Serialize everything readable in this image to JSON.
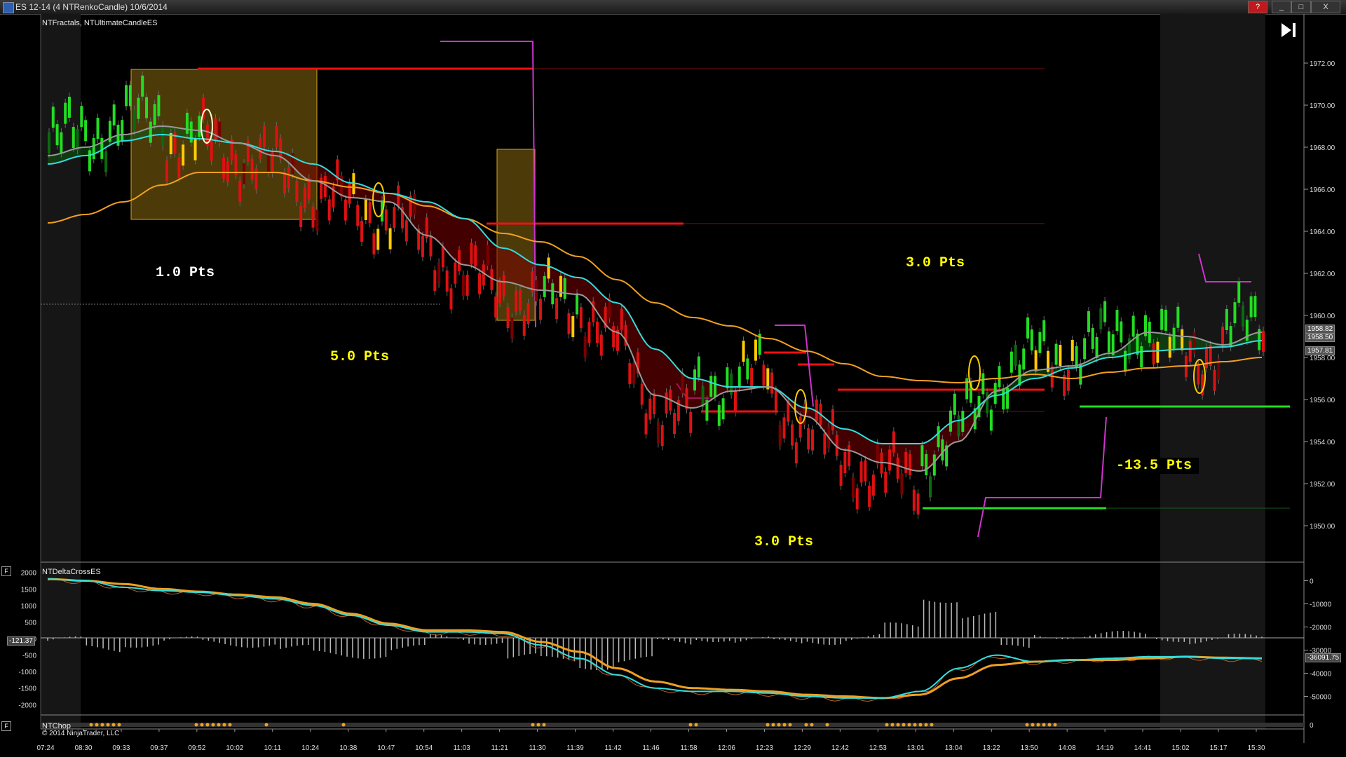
{
  "window": {
    "title": "ES 12-14 (4 NTRenkoCandle)  10/6/2014",
    "buttons": {
      "help": "?",
      "minimize": "_",
      "maximize": "□",
      "close": "X"
    }
  },
  "panels": {
    "price": {
      "label": "NTFractals, NTUltimateCandleES"
    },
    "delta": {
      "label": "NTDeltaCrossES"
    },
    "chop": {
      "label": "NTChop"
    }
  },
  "copyright": "© 2014 NinjaTrader, LLC",
  "panel_icons": {
    "delta_collapse": "F",
    "chop_collapse": "F"
  },
  "annotations": [
    {
      "text": "1.0 Pts",
      "color": "#ffffff"
    },
    {
      "text": "5.0 Pts",
      "color": "#ffff00"
    },
    {
      "text": "3.0 Pts",
      "color": "#ffff00"
    },
    {
      "text": "3.0 Pts",
      "color": "#ffff00"
    },
    {
      "text": "-13.5 Pts",
      "color": "#ffff00"
    }
  ],
  "price_labels": [
    "1958.82",
    "1958.50",
    "1957.81"
  ],
  "delta_left_label": "-121.37",
  "delta_right_label": "-36091.75",
  "price_axis": [
    "1972.00",
    "1970.00",
    "1968.00",
    "1966.00",
    "1964.00",
    "1962.00",
    "1960.00",
    "1958.00",
    "1956.00",
    "1954.00",
    "1952.00",
    "1950.00"
  ],
  "delta_left_axis": [
    "2000",
    "1500",
    "1000",
    "500",
    "0",
    "-500",
    "-1000",
    "-1500",
    "-2000"
  ],
  "delta_right_axis": [
    "0",
    "-10000",
    "-20000",
    "-30000",
    "-40000",
    "-50000"
  ],
  "chop_axis": [
    "0"
  ],
  "time_axis": [
    "07:24",
    "08:30",
    "09:33",
    "09:37",
    "09:52",
    "10:02",
    "10:11",
    "10:24",
    "10:38",
    "10:47",
    "10:54",
    "11:03",
    "11:21",
    "11:30",
    "11:39",
    "11:42",
    "11:46",
    "11:58",
    "12:06",
    "12:23",
    "12:29",
    "12:42",
    "12:53",
    "13:01",
    "13:04",
    "13:22",
    "13:50",
    "14:08",
    "14:19",
    "14:41",
    "15:02",
    "15:17",
    "15:30"
  ],
  "colors": {
    "bull": "#22dd22",
    "bear": "#dd1111",
    "neutral": "#ffcc00",
    "cyan_ma": "#33dddd",
    "orange_ma": "#f0a020",
    "gray_ma": "#999999",
    "fractal": "#cc33cc",
    "support": "#22dd22",
    "resistance": "#ee1111"
  },
  "chart_data": {
    "type": "line",
    "symbol": "ES 12-14",
    "bar_type": "4 NTRenkoCandle",
    "price_ylim": [
      1949,
      1973
    ],
    "cyan_ma": [
      1967.2,
      1967.6,
      1968.3,
      1968.6,
      1968.4,
      1968.2,
      1967.8,
      1967.2,
      1966.3,
      1965.8,
      1965.4,
      1964.6,
      1963.2,
      1962.4,
      1961.8,
      1960.6,
      1958.4,
      1957.0,
      1956.6,
      1956.6,
      1955.6,
      1954.6,
      1953.9,
      1953.9,
      1955.0,
      1956.2,
      1957.0,
      1957.5,
      1958.0,
      1958.3,
      1958.4,
      1958.5,
      1958.8
    ],
    "orange_ma": [
      1964.4,
      1964.8,
      1965.4,
      1966.2,
      1966.8,
      1966.8,
      1966.8,
      1966.4,
      1966.1,
      1965.8,
      1965.2,
      1964.6,
      1963.9,
      1963.5,
      1962.8,
      1961.7,
      1960.6,
      1959.9,
      1959.5,
      1958.9,
      1958.3,
      1957.7,
      1957.1,
      1956.9,
      1956.8,
      1957.0,
      1957.2,
      1957.0,
      1957.3,
      1957.5,
      1957.6,
      1957.8,
      1958.0
    ],
    "gray_ma": [
      1967.6,
      1968.0,
      1968.6,
      1969.0,
      1968.8,
      1968.2,
      1967.6,
      1966.4,
      1965.6,
      1965.4,
      1963.8,
      1962.4,
      1961.6,
      1961.2,
      1961.0,
      1959.2,
      1956.2,
      1955.6,
      1956.4,
      1956.6,
      1955.2,
      1953.6,
      1953.0,
      1952.6,
      1954.0,
      1956.4,
      1957.4,
      1957.6,
      1958.2,
      1959.2,
      1959.0,
      1958.6,
      1959.2
    ],
    "delta_cross": {
      "cyan": [
        1800,
        1750,
        1550,
        1450,
        1400,
        1300,
        1200,
        1000,
        700,
        400,
        200,
        200,
        150,
        -200,
        -600,
        -1100,
        -1500,
        -1600,
        -1600,
        -1650,
        -1750,
        -1800,
        -1800,
        -1600,
        -900,
        -500,
        -700,
        -650,
        -600,
        -550,
        -550,
        -600,
        -600
      ],
      "orange": [
        1800,
        1750,
        1650,
        1500,
        1420,
        1330,
        1250,
        1050,
        750,
        450,
        250,
        250,
        200,
        -100,
        -400,
        -900,
        -1300,
        -1500,
        -1550,
        -1600,
        -1700,
        -1750,
        -1800,
        -1700,
        -1200,
        -800,
        -700,
        -650,
        -650,
        -600,
        -550,
        -580,
        -600
      ],
      "left_ylim": [
        -2100,
        2100
      ],
      "right_ylim": [
        -55000,
        5000
      ]
    },
    "annotations_pts": [
      1.0,
      5.0,
      3.0,
      3.0,
      -13.5
    ]
  }
}
